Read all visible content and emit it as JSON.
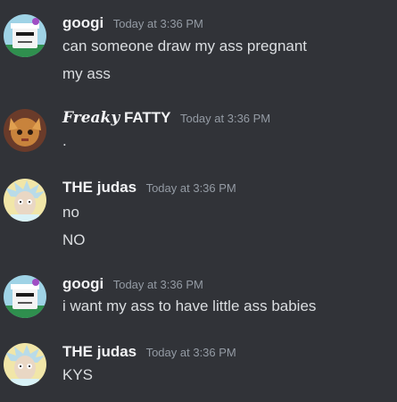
{
  "messages": [
    {
      "username": "googi",
      "timestamp": "Today at 3:36 PM",
      "lines": [
        "can someone draw my ass pregnant",
        "my ass"
      ]
    },
    {
      "username_fancy": "Freaky",
      "username_rest": " FATTY",
      "timestamp": "Today at 3:36 PM",
      "lines": [
        "."
      ]
    },
    {
      "username": "THE judas",
      "timestamp": "Today at 3:36 PM",
      "lines": [
        "no",
        "NO"
      ]
    },
    {
      "username": "googi",
      "timestamp": "Today at 3:36 PM",
      "lines": [
        "i want my ass to have little ass babies"
      ]
    },
    {
      "username": "THE judas",
      "timestamp": "Today at 3:36 PM",
      "lines": [
        "KYS"
      ]
    }
  ]
}
